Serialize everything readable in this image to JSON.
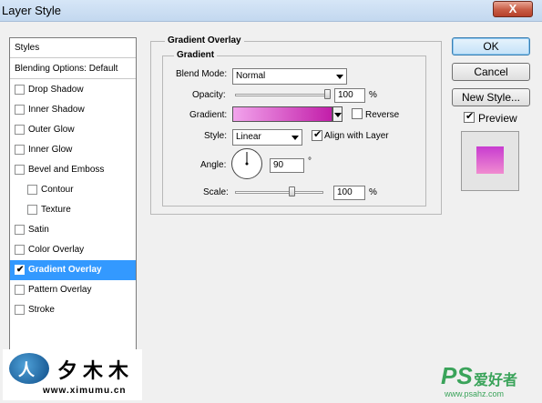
{
  "window": {
    "title": "Layer Style",
    "close_label": "X"
  },
  "styles_panel": {
    "header": "Styles",
    "blending_options": "Blending Options: Default",
    "items": [
      {
        "label": "Drop Shadow",
        "checked": false
      },
      {
        "label": "Inner Shadow",
        "checked": false
      },
      {
        "label": "Outer Glow",
        "checked": false
      },
      {
        "label": "Inner Glow",
        "checked": false
      },
      {
        "label": "Bevel and Emboss",
        "checked": false
      },
      {
        "label": "Contour",
        "checked": false
      },
      {
        "label": "Texture",
        "checked": false
      },
      {
        "label": "Satin",
        "checked": false
      },
      {
        "label": "Color Overlay",
        "checked": false
      },
      {
        "label": "Gradient Overlay",
        "checked": true,
        "selected": true
      },
      {
        "label": "Pattern Overlay",
        "checked": false
      },
      {
        "label": "Stroke",
        "checked": false
      }
    ]
  },
  "gradient_overlay": {
    "section_title": "Gradient Overlay",
    "group_title": "Gradient",
    "blend_mode_label": "Blend Mode:",
    "blend_mode_value": "Normal",
    "opacity_label": "Opacity:",
    "opacity_value": "100",
    "opacity_unit": "%",
    "gradient_label": "Gradient:",
    "gradient_colors": [
      "#f2a4ec",
      "#c21ea9"
    ],
    "reverse_label": "Reverse",
    "reverse_checked": false,
    "style_label": "Style:",
    "style_value": "Linear",
    "align_label": "Align with Layer",
    "align_checked": true,
    "angle_label": "Angle:",
    "angle_value": "90",
    "angle_unit": "°",
    "scale_label": "Scale:",
    "scale_value": "100",
    "scale_unit": "%"
  },
  "buttons": {
    "ok": "OK",
    "cancel": "Cancel",
    "new_style": "New Style...",
    "preview_label": "Preview",
    "preview_checked": true
  },
  "preview_swatch_colors": [
    "#c83cd0",
    "#f08cd0"
  ],
  "watermarks": {
    "left_cn": "夕木木",
    "left_url": "www.ximumu.cn",
    "right_logo": "PS",
    "right_cn": "爱好者",
    "right_url": "www.psahz.com"
  }
}
